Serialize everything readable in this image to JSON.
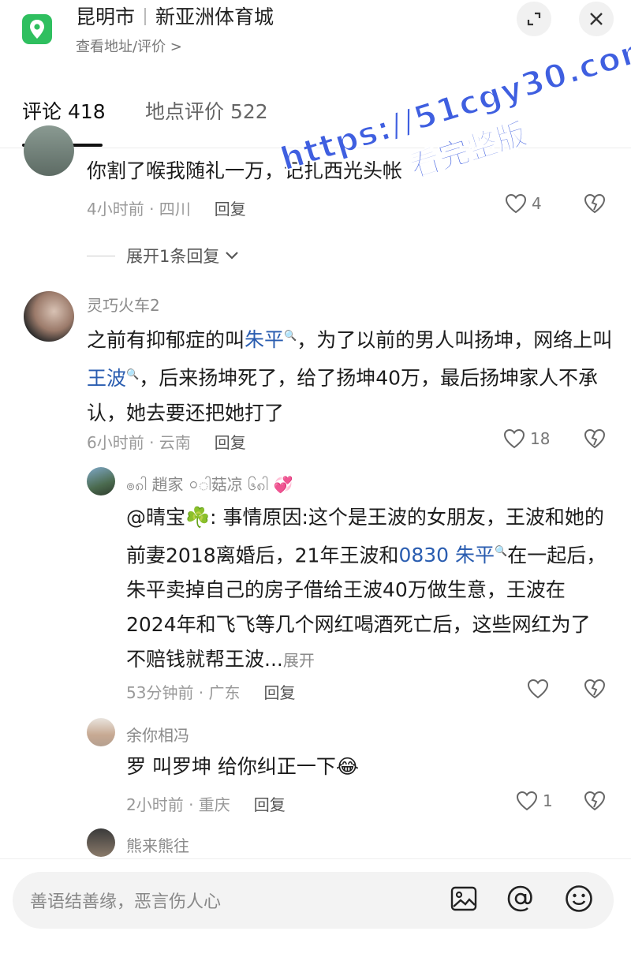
{
  "header": {
    "city": "昆明市",
    "place": "新亚洲体育城",
    "subtitle": "查看地址/评价 >",
    "icons": [
      "location-pin-icon",
      "expand-icon",
      "close-icon"
    ]
  },
  "tabs": [
    {
      "label": "评论 418",
      "active": true
    },
    {
      "label": "地点评价 522",
      "active": false
    }
  ],
  "comments": [
    {
      "text": "你割了喉我随礼一万，记扎西光头帐",
      "time_location": "4小时前 · 四川",
      "reply_label": "回复",
      "likes": "4",
      "expand_label": "展开1条回复"
    },
    {
      "username": "灵巧火车2",
      "text_parts": [
        "之前有抑郁症的叫",
        "朱平",
        "，为了以前的男人叫扬坤，网络上叫",
        "王波",
        "，后来扬坤死了，给了扬坤40万，最后扬坤家人不承认，她去要还把她打了"
      ],
      "time_location": "6小时前 · 云南",
      "reply_label": "回复",
      "likes": "18"
    },
    {
      "username": "ၜ၈ါ 趙家 ০ါ菇凉 ၆၈ါ",
      "text_parts": [
        "@晴宝☘️: 事情原因:这个是王波的女朋友，王波和她的前妻2018离婚后，21年王波和",
        "0830 朱平",
        "在一起后，朱平卖掉自己的房子借给王波40万做生意，王波在2024年和飞飞等几个网红喝酒死亡后，这些网红为了不赔钱就帮王波...",
        "展开"
      ],
      "time_location": "53分钟前 · 广东",
      "reply_label": "回复",
      "likes": ""
    },
    {
      "username": "余你相冯",
      "text": "罗 叫罗坤 给你纠正一下😂",
      "time_location": "2小时前 · 重庆",
      "reply_label": "回复",
      "likes": "1"
    },
    {
      "username": "熊来熊往"
    }
  ],
  "watermark": {
    "line1": "https://51cgy30.com",
    "line2": "看完整版"
  },
  "input": {
    "placeholder": "善语结善缘，恶言伤人心",
    "icons": [
      "image-icon",
      "at-icon",
      "emoji-icon"
    ]
  },
  "colors": {
    "brand_green": "#2fbf5f",
    "link_blue": "#2a5db0",
    "watermark_blue": "#3f5fe0"
  }
}
